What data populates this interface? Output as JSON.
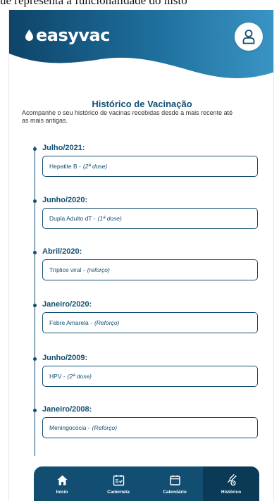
{
  "caption": "ue representa a funcionalidade do histó",
  "app": {
    "brand": "easyvac",
    "colors": {
      "primary": "#114e72",
      "header_gradient_start": "#0e4468",
      "header_gradient_end": "#3a95c4",
      "background": "#ffffff"
    }
  },
  "page": {
    "title": "Histórico de Vacinação",
    "subtitle": "Acompanhe o seu histórico de vacinas recebidas desde a mais recente até as mais antigas."
  },
  "history": [
    {
      "date": "Julho/2021:",
      "vaccine": "Hepatite B -",
      "dose": "(2ª dose)"
    },
    {
      "date": "Junho/2020:",
      "vaccine": "Dupla Adulto dT -",
      "dose": "(1ª dose)"
    },
    {
      "date": "Abril/2020:",
      "vaccine": "Tríplice viral -",
      "dose": "(reforço)"
    },
    {
      "date": "Janeiro/2020:",
      "vaccine": "Febre Amarela  -",
      "dose": "(Reforço)"
    },
    {
      "date": "Junho/2009:",
      "vaccine": "HPV -",
      "dose": "(2ª dose)"
    },
    {
      "date": "Janeiro/2008:",
      "vaccine": "Meningocócia -",
      "dose": "(Reforço)"
    }
  ],
  "nav": [
    {
      "label": "Início",
      "icon": "home-icon",
      "active": false
    },
    {
      "label": "Caderneta",
      "icon": "vaccine-card-icon",
      "active": false
    },
    {
      "label": "Calendário",
      "icon": "calendar-icon",
      "active": false
    },
    {
      "label": "Histórico",
      "icon": "syringe-history-icon",
      "active": true
    }
  ]
}
